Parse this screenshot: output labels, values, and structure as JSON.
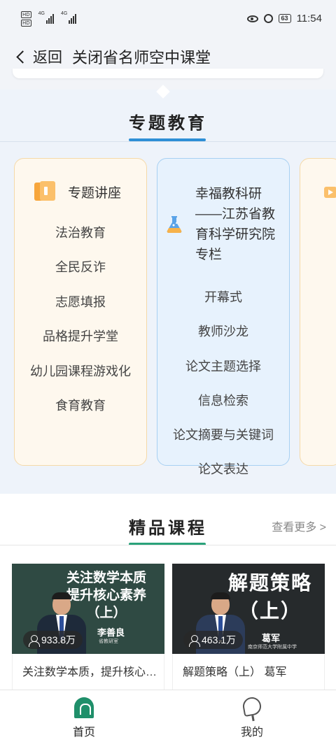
{
  "status_bar": {
    "hd_1": "HD",
    "hd_2": "HD",
    "net_1": "4G",
    "net_2": "4G",
    "battery": "63",
    "time": "11:54"
  },
  "nav": {
    "back_label": "返回",
    "title": "关闭省名师空中课堂"
  },
  "zhuanti": {
    "title": "专题教育",
    "cards": [
      {
        "title": "专题讲座",
        "icon": "book-icon",
        "items": [
          "法治教育",
          "全民反诈",
          "志愿填报",
          "品格提升学堂",
          "幼儿园课程游戏化",
          "食育教育"
        ]
      },
      {
        "title": "幸福教科研——江苏省教育科学研究院专栏",
        "icon": "flask-icon",
        "items": [
          "开幕式",
          "教师沙龙",
          "论文主题选择",
          "信息检索",
          "论文摘要与关键词",
          "论文表达"
        ]
      }
    ]
  },
  "jingpin": {
    "title": "精品课程",
    "see_more": "查看更多 >",
    "courses": [
      {
        "thumb_text": "关注数学本质\n提升核心素养\n（上）",
        "presenter": "李善良",
        "presenter_sub": "省教研室",
        "views": "933.8万",
        "title": "关注数学本质，提升核心素养（上）"
      },
      {
        "thumb_text": "解题策略\n（上）",
        "presenter": "葛军",
        "presenter_sub": "南京师范大学附属中学",
        "views": "463.1万",
        "title": "解题策略（上） 葛军"
      }
    ]
  },
  "tabbar": {
    "home": "首页",
    "me": "我的"
  },
  "colors": {
    "accent_blue": "#2e8fd6",
    "accent_green": "#1f8f6a"
  }
}
